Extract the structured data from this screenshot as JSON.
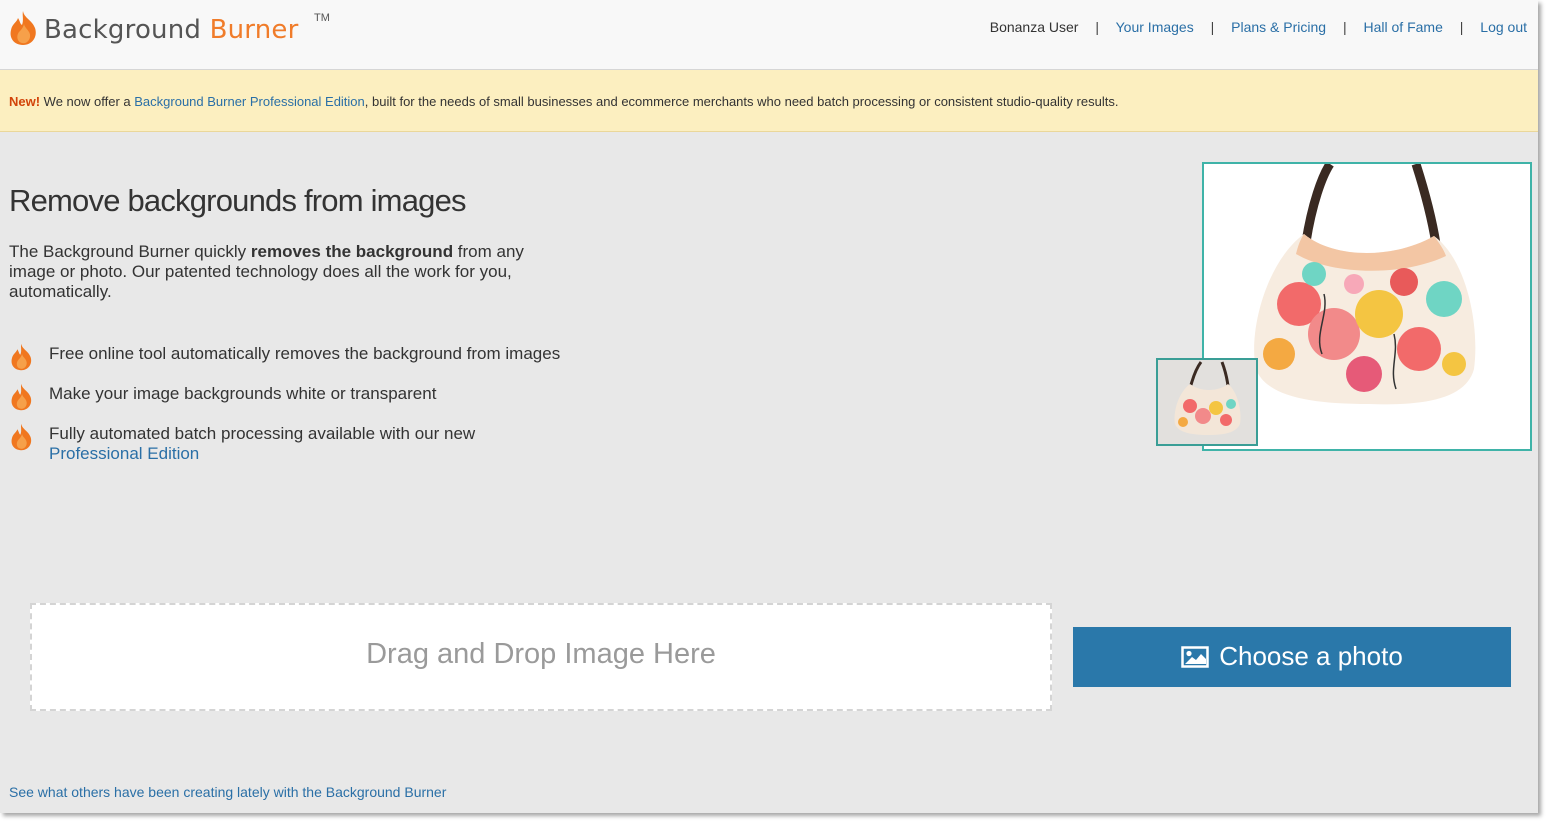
{
  "header": {
    "brand_word1": "Background",
    "brand_word2": "Burner",
    "trademark": "TM",
    "user_name": "Bonanza User",
    "nav": {
      "your_images": "Your Images",
      "plans_pricing": "Plans & Pricing",
      "hall_of_fame": "Hall of Fame",
      "log_out": "Log out"
    },
    "separator": "|"
  },
  "notice": {
    "badge": "New!",
    "text_before": " We now offer a ",
    "link": "Background Burner Professional Edition",
    "text_after": ", built for the needs of small businesses and ecommerce merchants who need batch processing or consistent studio-quality results."
  },
  "hero": {
    "title": "Remove backgrounds from images",
    "desc_before": "The Background Burner quickly ",
    "desc_bold": "removes the background",
    "desc_after": " from any image or photo. Our patented technology does all the work for you, automatically."
  },
  "features": [
    {
      "text": "Free online tool automatically removes the background from images"
    },
    {
      "text": "Make your image backgrounds white or transparent"
    },
    {
      "text": "Fully automated batch processing available with our new ",
      "link": "Professional Edition"
    }
  ],
  "upload": {
    "dropzone_text": "Drag and Drop Image Here",
    "choose_label": "Choose a photo"
  },
  "footer": {
    "link": "See what others have been creating lately with the Background Burner"
  },
  "colors": {
    "accent_orange": "#f07c2a",
    "link_blue": "#2a6fa6",
    "button_blue": "#2a78aa",
    "notice_bg": "#fcefc0",
    "preview_border": "#3fb3a8"
  },
  "icons": {
    "logo": "flame-icon",
    "feature_bullet": "flame-icon",
    "choose_button": "picture-icon"
  }
}
